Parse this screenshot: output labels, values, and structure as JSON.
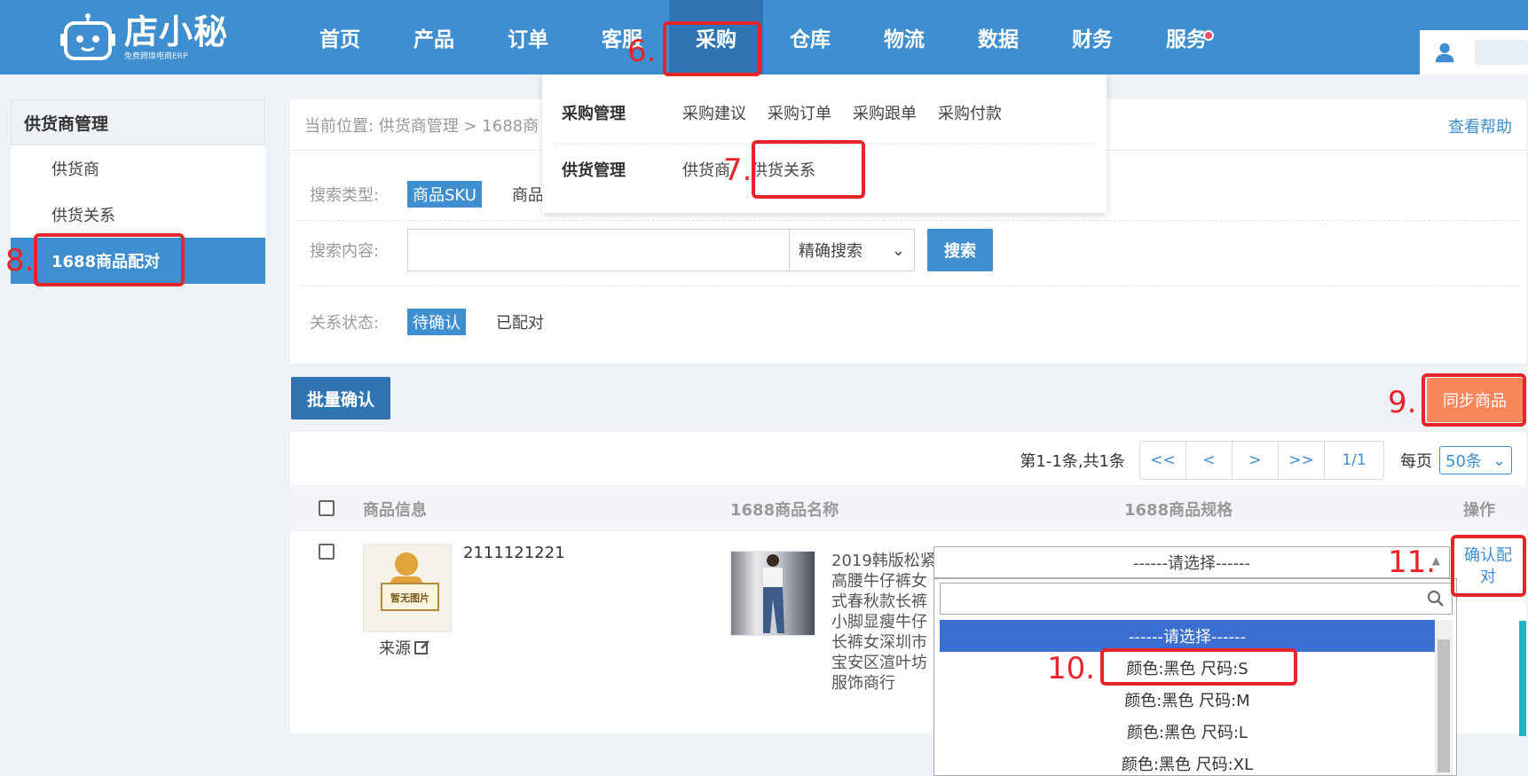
{
  "logo": {
    "name": "店小秘",
    "tagline": "免费跨境电商ERP"
  },
  "nav": {
    "items": [
      "首页",
      "产品",
      "订单",
      "客服",
      "采购",
      "仓库",
      "物流",
      "数据",
      "财务",
      "服务"
    ],
    "active": "采购"
  },
  "menu": {
    "group1_title": "采购管理",
    "group1_items": [
      "采购建议",
      "采购订单",
      "采购跟单",
      "采购付款"
    ],
    "group2_title": "供货管理",
    "group2_items": [
      "供货商",
      "供货关系"
    ]
  },
  "sidebar": {
    "title": "供货商管理",
    "items": [
      "供货商",
      "供货关系",
      "1688商品配对"
    ]
  },
  "breadcrumb": "当前位置:  供货商管理 > 1688商",
  "help_label": "查看帮助",
  "filters": {
    "search_type_label": "搜索类型:",
    "search_type_active": "商品SKU",
    "search_type_other": "商品",
    "search_content_label": "搜索内容:",
    "search_mode": "精确搜索",
    "search_button": "搜索",
    "status_label": "关系状态:",
    "status_active": "待确认",
    "status_other": "已配对"
  },
  "batch_confirm_label": "批量确认",
  "sync_label": "同步商品",
  "pager": {
    "summary": "第1-1条,共1条",
    "first": "<<",
    "prev": "<",
    "next": ">",
    "last": ">>",
    "page": "1/1",
    "per_page_label": "每页",
    "per_page_value": "50条"
  },
  "table": {
    "headers": [
      "商品信息",
      "1688商品名称",
      "1688商品规格",
      "操作"
    ],
    "row": {
      "sku": "2111121221",
      "no_image_label": "暂无图片",
      "source_label": "来源",
      "title_1688": "2019韩版松紧高腰牛仔裤女式春秋款长裤小脚显瘦牛仔长裤女深圳市宝安区渲叶坊服饰商行",
      "confirm_label": "确认配对"
    }
  },
  "spec_select": {
    "placeholder": "------请选择------",
    "options": [
      "------请选择------",
      "颜色:黑色 尺码:S",
      "颜色:黑色 尺码:M",
      "颜色:黑色 尺码:L",
      "颜色:黑色 尺码:XL"
    ]
  },
  "annotations": [
    "6.",
    "7.",
    "8.",
    "9.",
    "10.",
    "11."
  ],
  "colors": {
    "primary": "#3e8ed0",
    "annotation": "#e8232a",
    "sync": "#f9865a"
  }
}
